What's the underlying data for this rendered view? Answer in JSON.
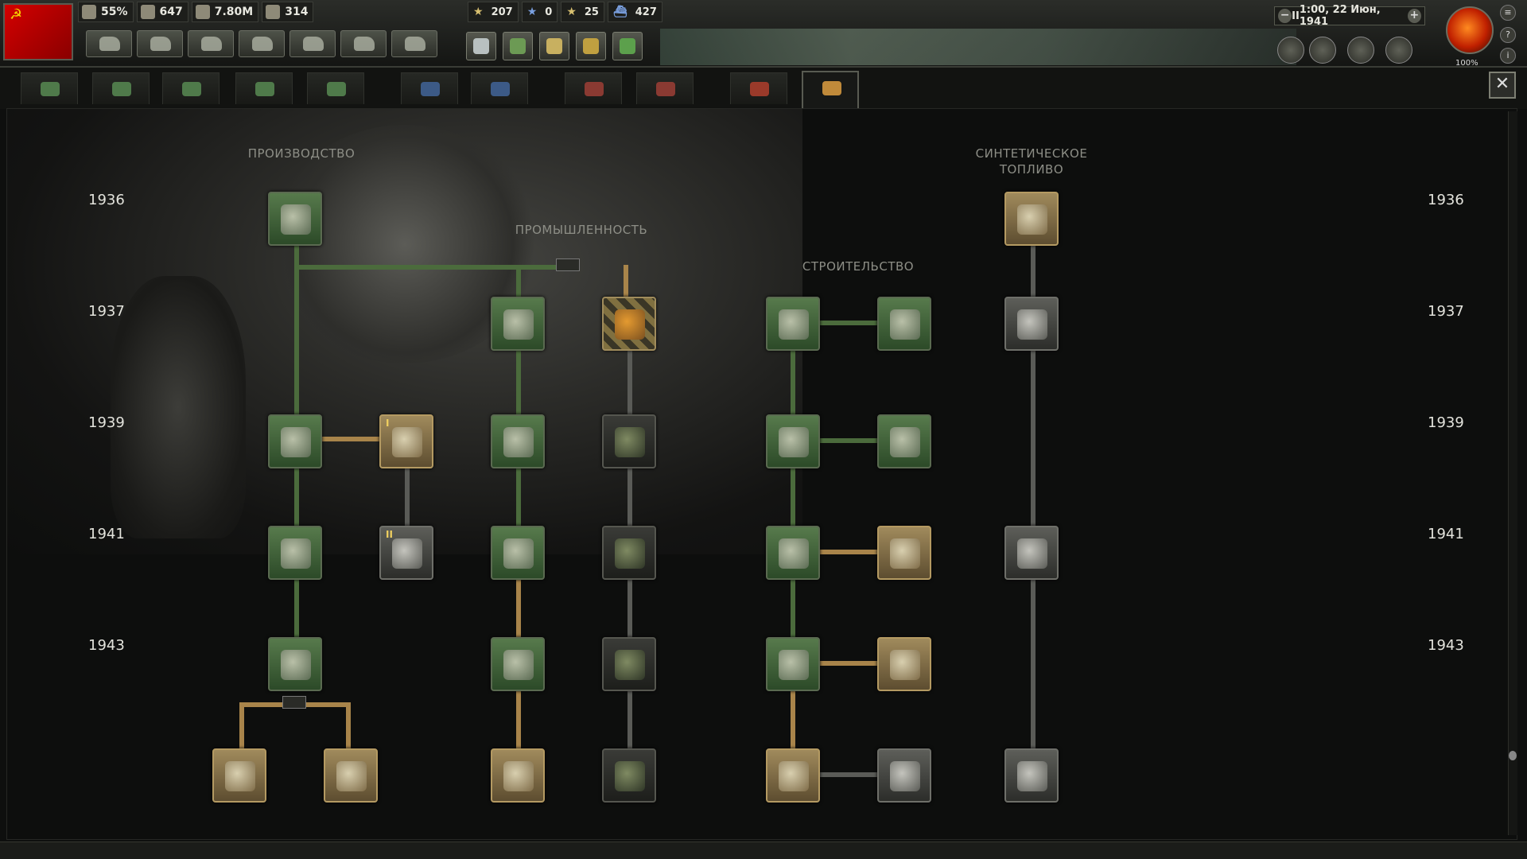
{
  "topbar": {
    "resources": [
      {
        "icon": "stability-icon",
        "value": "55%"
      },
      {
        "icon": "political-power-icon",
        "value": "647"
      },
      {
        "icon": "manpower-icon",
        "value": "7.80M"
      },
      {
        "icon": "factories-icon",
        "value": "314"
      }
    ],
    "military": [
      {
        "icon": "army-star-icon",
        "value": "207"
      },
      {
        "icon": "navy-star-icon",
        "value": "0"
      },
      {
        "icon": "air-star-icon",
        "value": "25"
      },
      {
        "icon": "convoy-icon",
        "value": "427"
      }
    ],
    "date": "1:00, 22 Июн, 1941",
    "pause_symbol": "II",
    "speed_minus": "−",
    "speed_plus": "+",
    "zoom": "100%",
    "flag_symbol": "☭"
  },
  "tabs": [
    {
      "icon": "infantry-tab-icon",
      "color": "#4f7a4a"
    },
    {
      "icon": "support-tab-icon",
      "color": "#4f7a4a"
    },
    {
      "icon": "armor-tab-icon",
      "color": "#4f7a4a"
    },
    {
      "icon": "artillery-tab-icon",
      "color": "#4f7a4a"
    },
    {
      "icon": "land-doctrine-tab-icon",
      "color": "#4f7a4a"
    },
    {
      "icon": "naval-tab-icon",
      "color": "#3c5a86"
    },
    {
      "icon": "naval-doctrine-tab-icon",
      "color": "#3c5a86"
    },
    {
      "icon": "air-tab-icon",
      "color": "#8a3a32"
    },
    {
      "icon": "air-doctrine-tab-icon",
      "color": "#8a3a32"
    },
    {
      "icon": "electronics-tab-icon",
      "color": "#9a3a2a"
    },
    {
      "icon": "industry-tab-icon",
      "color": "#c08a3a"
    }
  ],
  "close_label": "✕",
  "categories": {
    "production": "ПРОИЗВОДСТВО",
    "industry": "ПРОМЫШЛЕННОСТЬ",
    "construction": "СТРОИТЕЛЬСТВО",
    "synthetic_line1": "СИНТЕТИЧЕСКОЕ",
    "synthetic_line2": "ТОПЛИВО"
  },
  "years": [
    "1936",
    "1937",
    "1939",
    "1941",
    "1943"
  ],
  "techs": [
    {
      "name": "basic-machine-tools",
      "icon": "machine-tools-icon",
      "state": "green"
    },
    {
      "name": "improved-machine-tools",
      "icon": "drill-icon",
      "state": "green"
    },
    {
      "name": "advanced-machine-tools",
      "icon": "tools-gear-icon",
      "state": "green"
    },
    {
      "name": "assembly-line-production",
      "icon": "shells-icon",
      "state": "green"
    },
    {
      "name": "flexible-line",
      "icon": "shells-line-icon",
      "state": "gold"
    },
    {
      "name": "streamlined-line",
      "icon": "shells-stream-icon",
      "state": "gold"
    },
    {
      "name": "dispersed-industry-1",
      "icon": "recycle-factory-icon",
      "state": "gold",
      "roman": "I"
    },
    {
      "name": "dispersed-industry-2",
      "icon": "recycle-factory-icon",
      "state": "grey",
      "roman": "II"
    },
    {
      "name": "fundamental-industry",
      "icon": "factory-icon",
      "state": "green"
    },
    {
      "name": "industry-1937",
      "icon": "factory-icon",
      "state": "green"
    },
    {
      "name": "industry-1939",
      "icon": "factory-icon",
      "state": "green"
    },
    {
      "name": "industry-1941",
      "icon": "factory-icon",
      "state": "green"
    },
    {
      "name": "industry-1943",
      "icon": "factory-icon",
      "state": "gold"
    },
    {
      "name": "dispersed-1936",
      "icon": "dispersed-factory-icon",
      "state": "hatched"
    },
    {
      "name": "dispersed-1937",
      "icon": "dispersed-factory-icon",
      "state": "dark"
    },
    {
      "name": "dispersed-1939",
      "icon": "dispersed-factory-icon",
      "state": "dark"
    },
    {
      "name": "dispersed-1941",
      "icon": "camouflage-factory-icon",
      "state": "dark"
    },
    {
      "name": "dispersed-1943",
      "icon": "camouflage-factory-icon",
      "state": "dark"
    },
    {
      "name": "construction-1",
      "icon": "girder-icon",
      "state": "green"
    },
    {
      "name": "excavation-1",
      "icon": "shovel-ore-icon",
      "state": "green"
    },
    {
      "name": "construction-2",
      "icon": "cement-mixer-icon",
      "state": "green"
    },
    {
      "name": "excavation-2",
      "icon": "drill-ore-icon",
      "state": "green"
    },
    {
      "name": "construction-3",
      "icon": "crane-truck-icon",
      "state": "green"
    },
    {
      "name": "excavation-3",
      "icon": "pumpjack-icon",
      "state": "gold"
    },
    {
      "name": "construction-4",
      "icon": "bulldozer-icon",
      "state": "green"
    },
    {
      "name": "excavation-4",
      "icon": "mining-truck-icon",
      "state": "gold"
    },
    {
      "name": "construction-5",
      "icon": "heavy-machinery-icon",
      "state": "gold"
    },
    {
      "name": "excavation-5",
      "icon": "oil-derricks-icon",
      "state": "grey"
    },
    {
      "name": "oil-processing",
      "icon": "oil-drop-icon",
      "state": "gold"
    },
    {
      "name": "improved-oil-processing",
      "icon": "refinery-icon",
      "state": "grey"
    },
    {
      "name": "advanced-oil-processing",
      "icon": "refinery-icon",
      "state": "grey"
    },
    {
      "name": "synthetic-rubber",
      "icon": "refinery-rubber-icon",
      "state": "grey"
    }
  ]
}
